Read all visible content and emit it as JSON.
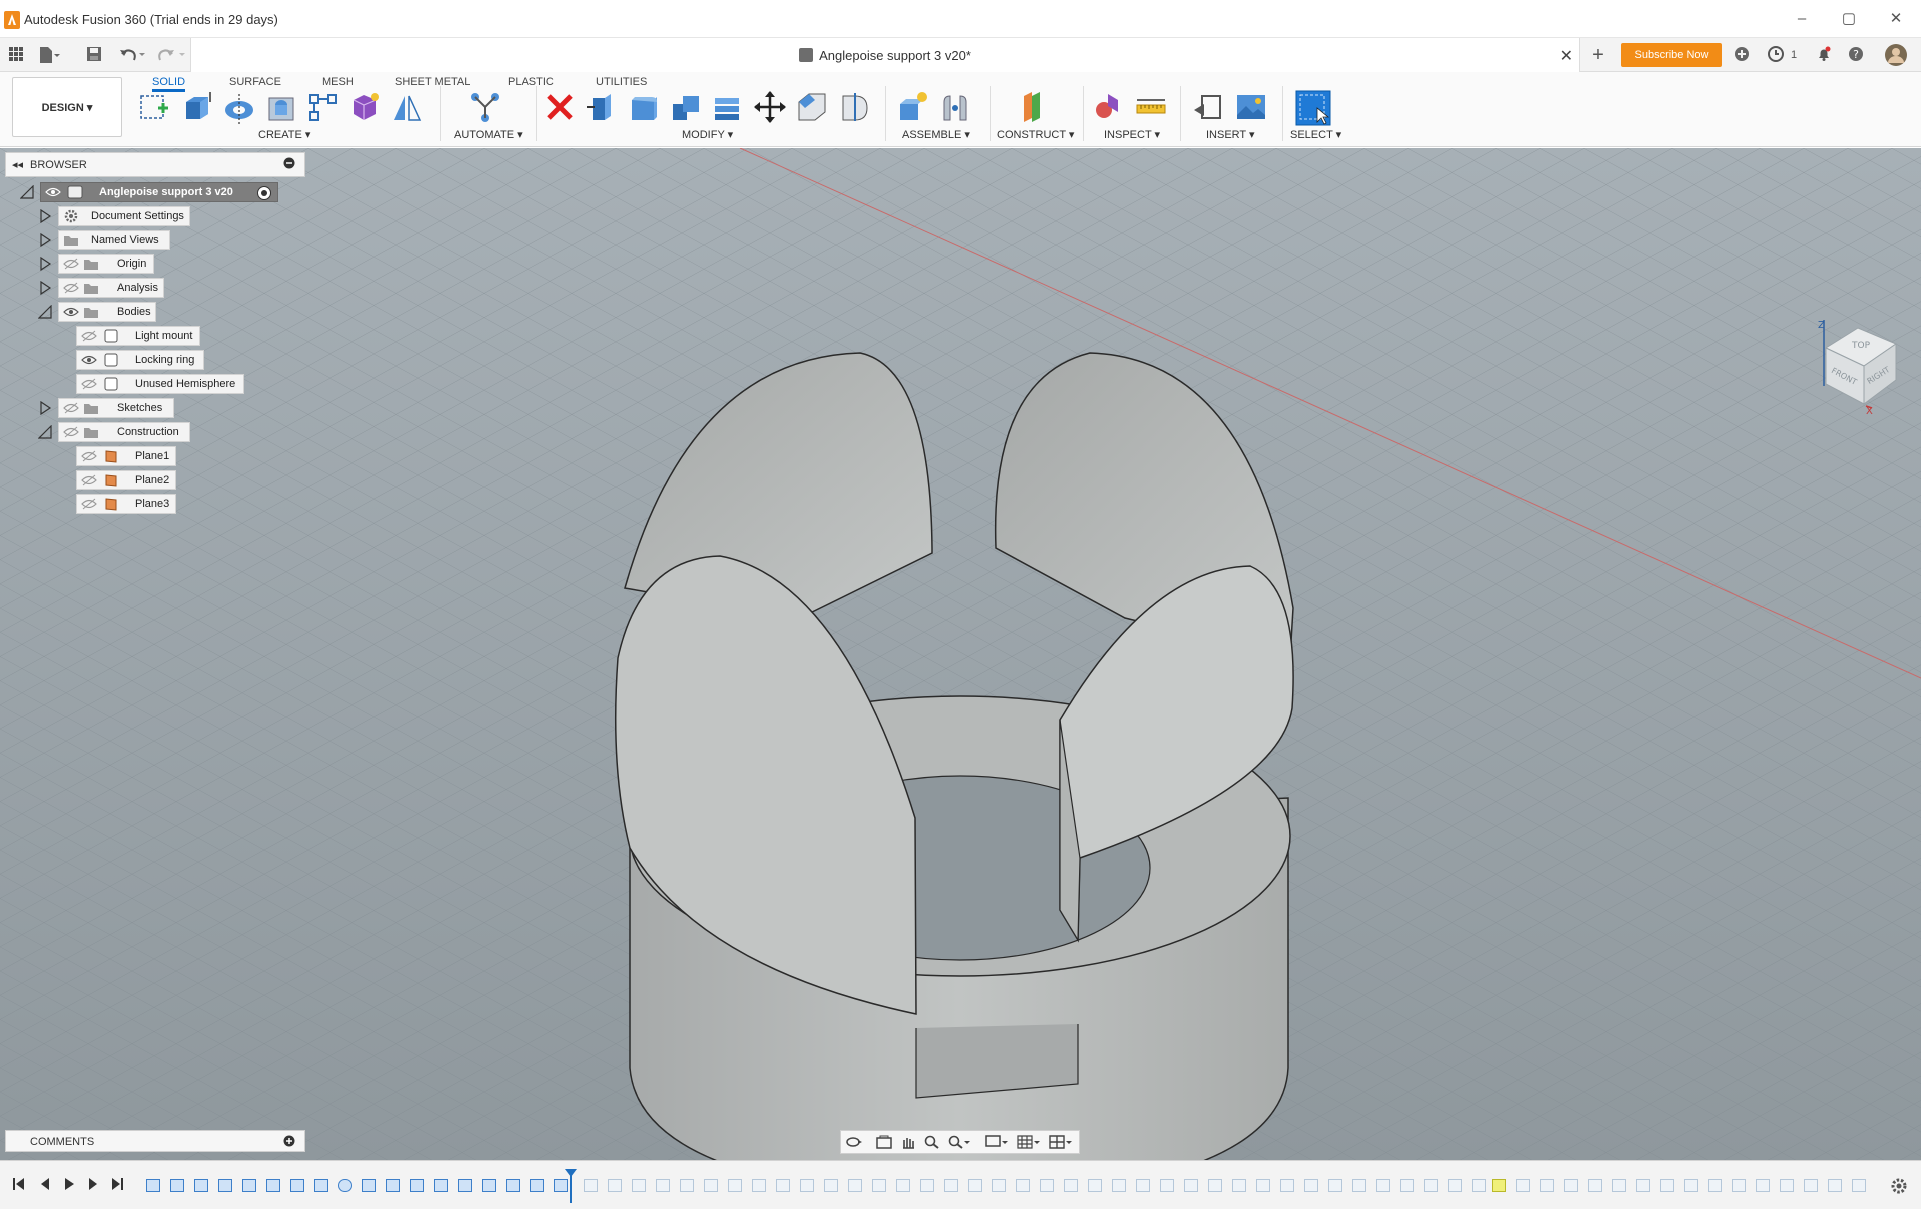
{
  "window": {
    "title": "Autodesk Fusion 360 (Trial ends in 29 days)",
    "controls": [
      "–",
      "▢",
      "✕"
    ]
  },
  "quick_access": {
    "document_title": "Anglepoise support 3 v20*",
    "close_glyph": "✕",
    "new_tab_glyph": "+",
    "subscribe_label": "Subscribe Now",
    "job_count": "1"
  },
  "ribbon": {
    "workspace_label": "DESIGN ▾",
    "tabs": [
      "SOLID",
      "SURFACE",
      "MESH",
      "SHEET METAL",
      "PLASTIC",
      "UTILITIES"
    ],
    "active_tab": "SOLID",
    "groups": [
      "CREATE ▾",
      "AUTOMATE ▾",
      "MODIFY ▾",
      "ASSEMBLE ▾",
      "CONSTRUCT ▾",
      "INSPECT ▾",
      "INSERT ▾",
      "SELECT ▾"
    ]
  },
  "browser": {
    "header": "BROWSER",
    "collapse_glyph": "◂◂",
    "items": [
      {
        "label": "Anglepoise support 3 v20",
        "icon": "component-icon"
      },
      {
        "label": "Document Settings",
        "icon": "gear-icon"
      },
      {
        "label": "Named Views",
        "icon": "folder-icon"
      },
      {
        "label": "Origin",
        "icon": "folder-icon"
      },
      {
        "label": "Analysis",
        "icon": "folder-icon"
      },
      {
        "label": "Bodies",
        "icon": "folder-icon"
      },
      {
        "label": "Light mount",
        "icon": "body-icon"
      },
      {
        "label": "Locking ring",
        "icon": "body-icon"
      },
      {
        "label": "Unused Hemisphere",
        "icon": "body-icon"
      },
      {
        "label": "Sketches",
        "icon": "folder-icon"
      },
      {
        "label": "Construction",
        "icon": "folder-icon"
      },
      {
        "label": "Plane1",
        "icon": "plane-icon"
      },
      {
        "label": "Plane2",
        "icon": "plane-icon"
      },
      {
        "label": "Plane3",
        "icon": "plane-icon"
      }
    ]
  },
  "comments": {
    "label": "COMMENTS"
  },
  "viewcube": {
    "faces": [
      "TOP",
      "FRONT",
      "RIGHT"
    ],
    "axes": [
      "Z",
      "X"
    ]
  },
  "colors": {
    "accent": "#0a69c6",
    "subscribe": "#f28c16",
    "model": "#b7bbba",
    "grid_bg": "#8c969c"
  }
}
